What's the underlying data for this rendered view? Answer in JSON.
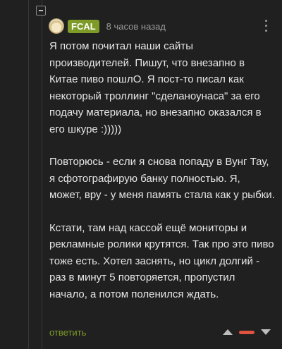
{
  "comment": {
    "author": "FCAL",
    "time": "8 часов назад",
    "paragraphs": [
      "Я потом почитал наши сайты производителей. Пишут, что внезапно в Китае пиво пошлО. Я пост-то писал как некоторый троллинг \"сделаноунаса\" за его подачу материала, но внезапно оказался в его шкуре :)))))",
      "Повторюсь - если я снова попаду в Вунг Тау, я сфотографирую банку полностью. Я, может, вру - у меня память стала как у рыбки.",
      "Кстати, там над кассой ещё мониторы и рекламные ролики крутятся. Так про это пиво тоже есть. Хотел заснять, но цикл долгий - раз в минут 5 повторяется, пропустил начало, а потом поленился ждать."
    ],
    "reply_label": "ответить",
    "rating_color": "#e0533e",
    "author_badge_color": "#7e9b28",
    "icons": [
      "collapse-icon",
      "avatar",
      "more-vertical-icon",
      "arrow-up-icon",
      "arrow-down-icon"
    ]
  }
}
